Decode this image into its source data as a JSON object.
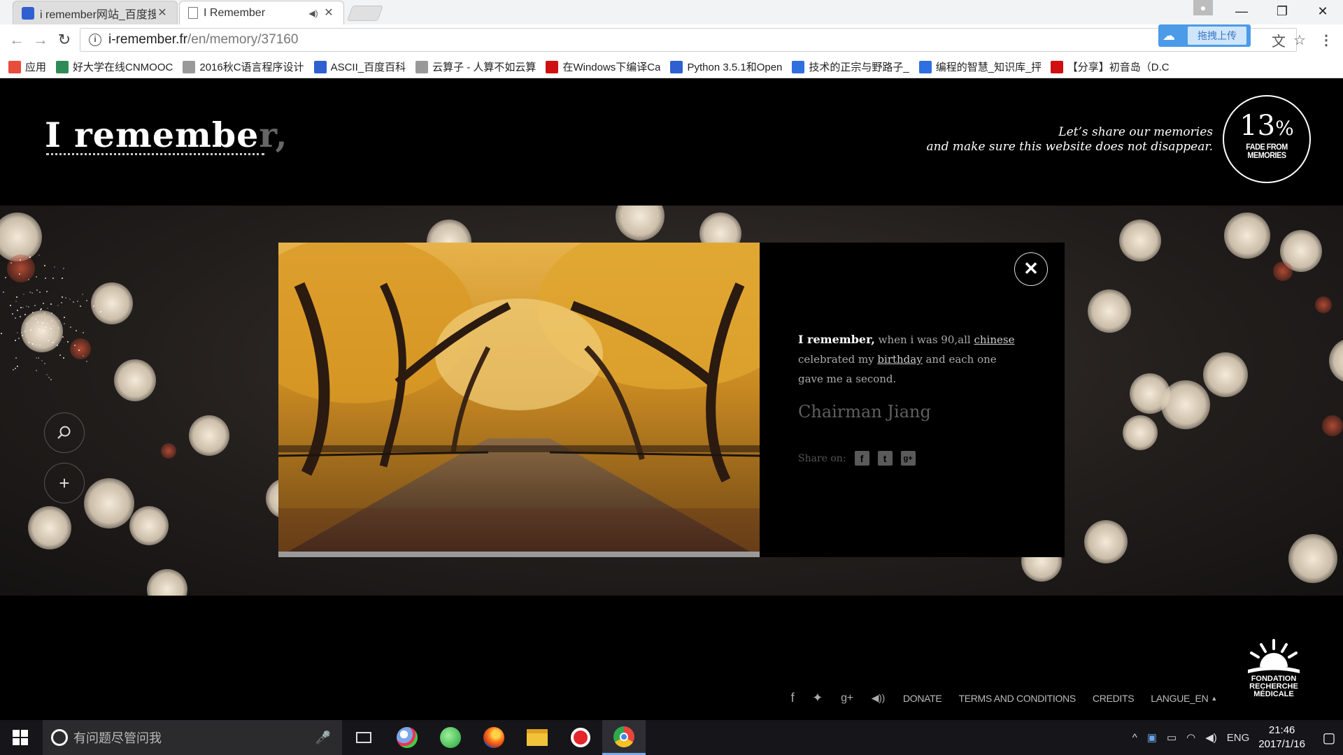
{
  "browser": {
    "tabs": [
      {
        "title": "i remember网站_百度搜",
        "icon": "baidu-paw-icon",
        "active": false
      },
      {
        "title": "I Remember",
        "icon": "page-icon",
        "active": true,
        "audio": "speaker-icon"
      }
    ],
    "address": {
      "host": "i-remember.fr",
      "path": "/en/memory/37160"
    },
    "upload_badge": "拖拽上传",
    "bookmarks": [
      {
        "label": "应用",
        "icon": "apps-grid-icon",
        "color": "#e74c3c"
      },
      {
        "label": "好大学在线CNMOOC",
        "icon": "book-icon",
        "color": "#2e8b57"
      },
      {
        "label": "2016秋C语言程序设计",
        "icon": "page-icon",
        "color": "#999999"
      },
      {
        "label": "ASCII_百度百科",
        "icon": "baidu-paw-icon",
        "color": "#2f5fd0"
      },
      {
        "label": "云算子 - 人算不如云算",
        "icon": "page-icon",
        "color": "#999999"
      },
      {
        "label": "在Windows下编译Ca",
        "icon": "csdn-icon",
        "color": "#d01010"
      },
      {
        "label": "Python 3.5.1和Open",
        "icon": "baidu-paw-icon",
        "color": "#2f5fd0"
      },
      {
        "label": "技术的正宗与野路子_",
        "icon": "zhidao-icon",
        "color": "#2f6fe0"
      },
      {
        "label": "编程的智慧_知识库_抨",
        "icon": "zhidao-icon",
        "color": "#2f6fe0"
      },
      {
        "label": "【分享】初音岛（D.C",
        "icon": "csdn-icon",
        "color": "#d01010"
      }
    ]
  },
  "site": {
    "logo_main": "I remembe",
    "logo_fade": "r,",
    "tagline_line1": "Let’s share our memories",
    "tagline_line2": "and make sure this website does not disappear.",
    "fade_percent": "13",
    "fade_percent_sign": "%",
    "fade_caption_1": "FADE FROM",
    "fade_caption_2": "MEMORIES",
    "search_icon": "search-icon",
    "add_icon": "plus-icon"
  },
  "memory": {
    "lead": "I remember,",
    "text_1": " when i was 90,all ",
    "link_1": "chinese",
    "text_2": " celebrated my ",
    "link_2": "birthday",
    "text_3": " and each one gave me a second.",
    "author": "Chairman Jiang",
    "share_label": "Share on:",
    "share_icons": [
      "facebook-icon",
      "twitter-icon",
      "googleplus-icon"
    ],
    "close_icon": "close-icon"
  },
  "footer": {
    "social_icons": [
      "facebook-icon",
      "twitter-icon",
      "googleplus-icon",
      "speaker-icon"
    ],
    "links": [
      "DONATE",
      "TERMS AND CONDITIONS",
      "CREDITS",
      "LANGUE_EN"
    ],
    "foundation_1": "FONDATION",
    "foundation_2": "RECHERCHE",
    "foundation_3": "MÉDICALE"
  },
  "taskbar": {
    "search_placeholder": "有问题尽管问我",
    "apps": [
      "task-view-icon",
      "paint-icon",
      "green-app-icon",
      "firefox-icon",
      "file-explorer-icon",
      "netease-music-icon",
      "chrome-icon"
    ],
    "ime": "ENG",
    "time": "21:46",
    "date": "2017/1/16"
  },
  "colors": {
    "accent": "#4b9be8",
    "page_bg": "#000000",
    "text_muted": "#aaaaaa"
  }
}
